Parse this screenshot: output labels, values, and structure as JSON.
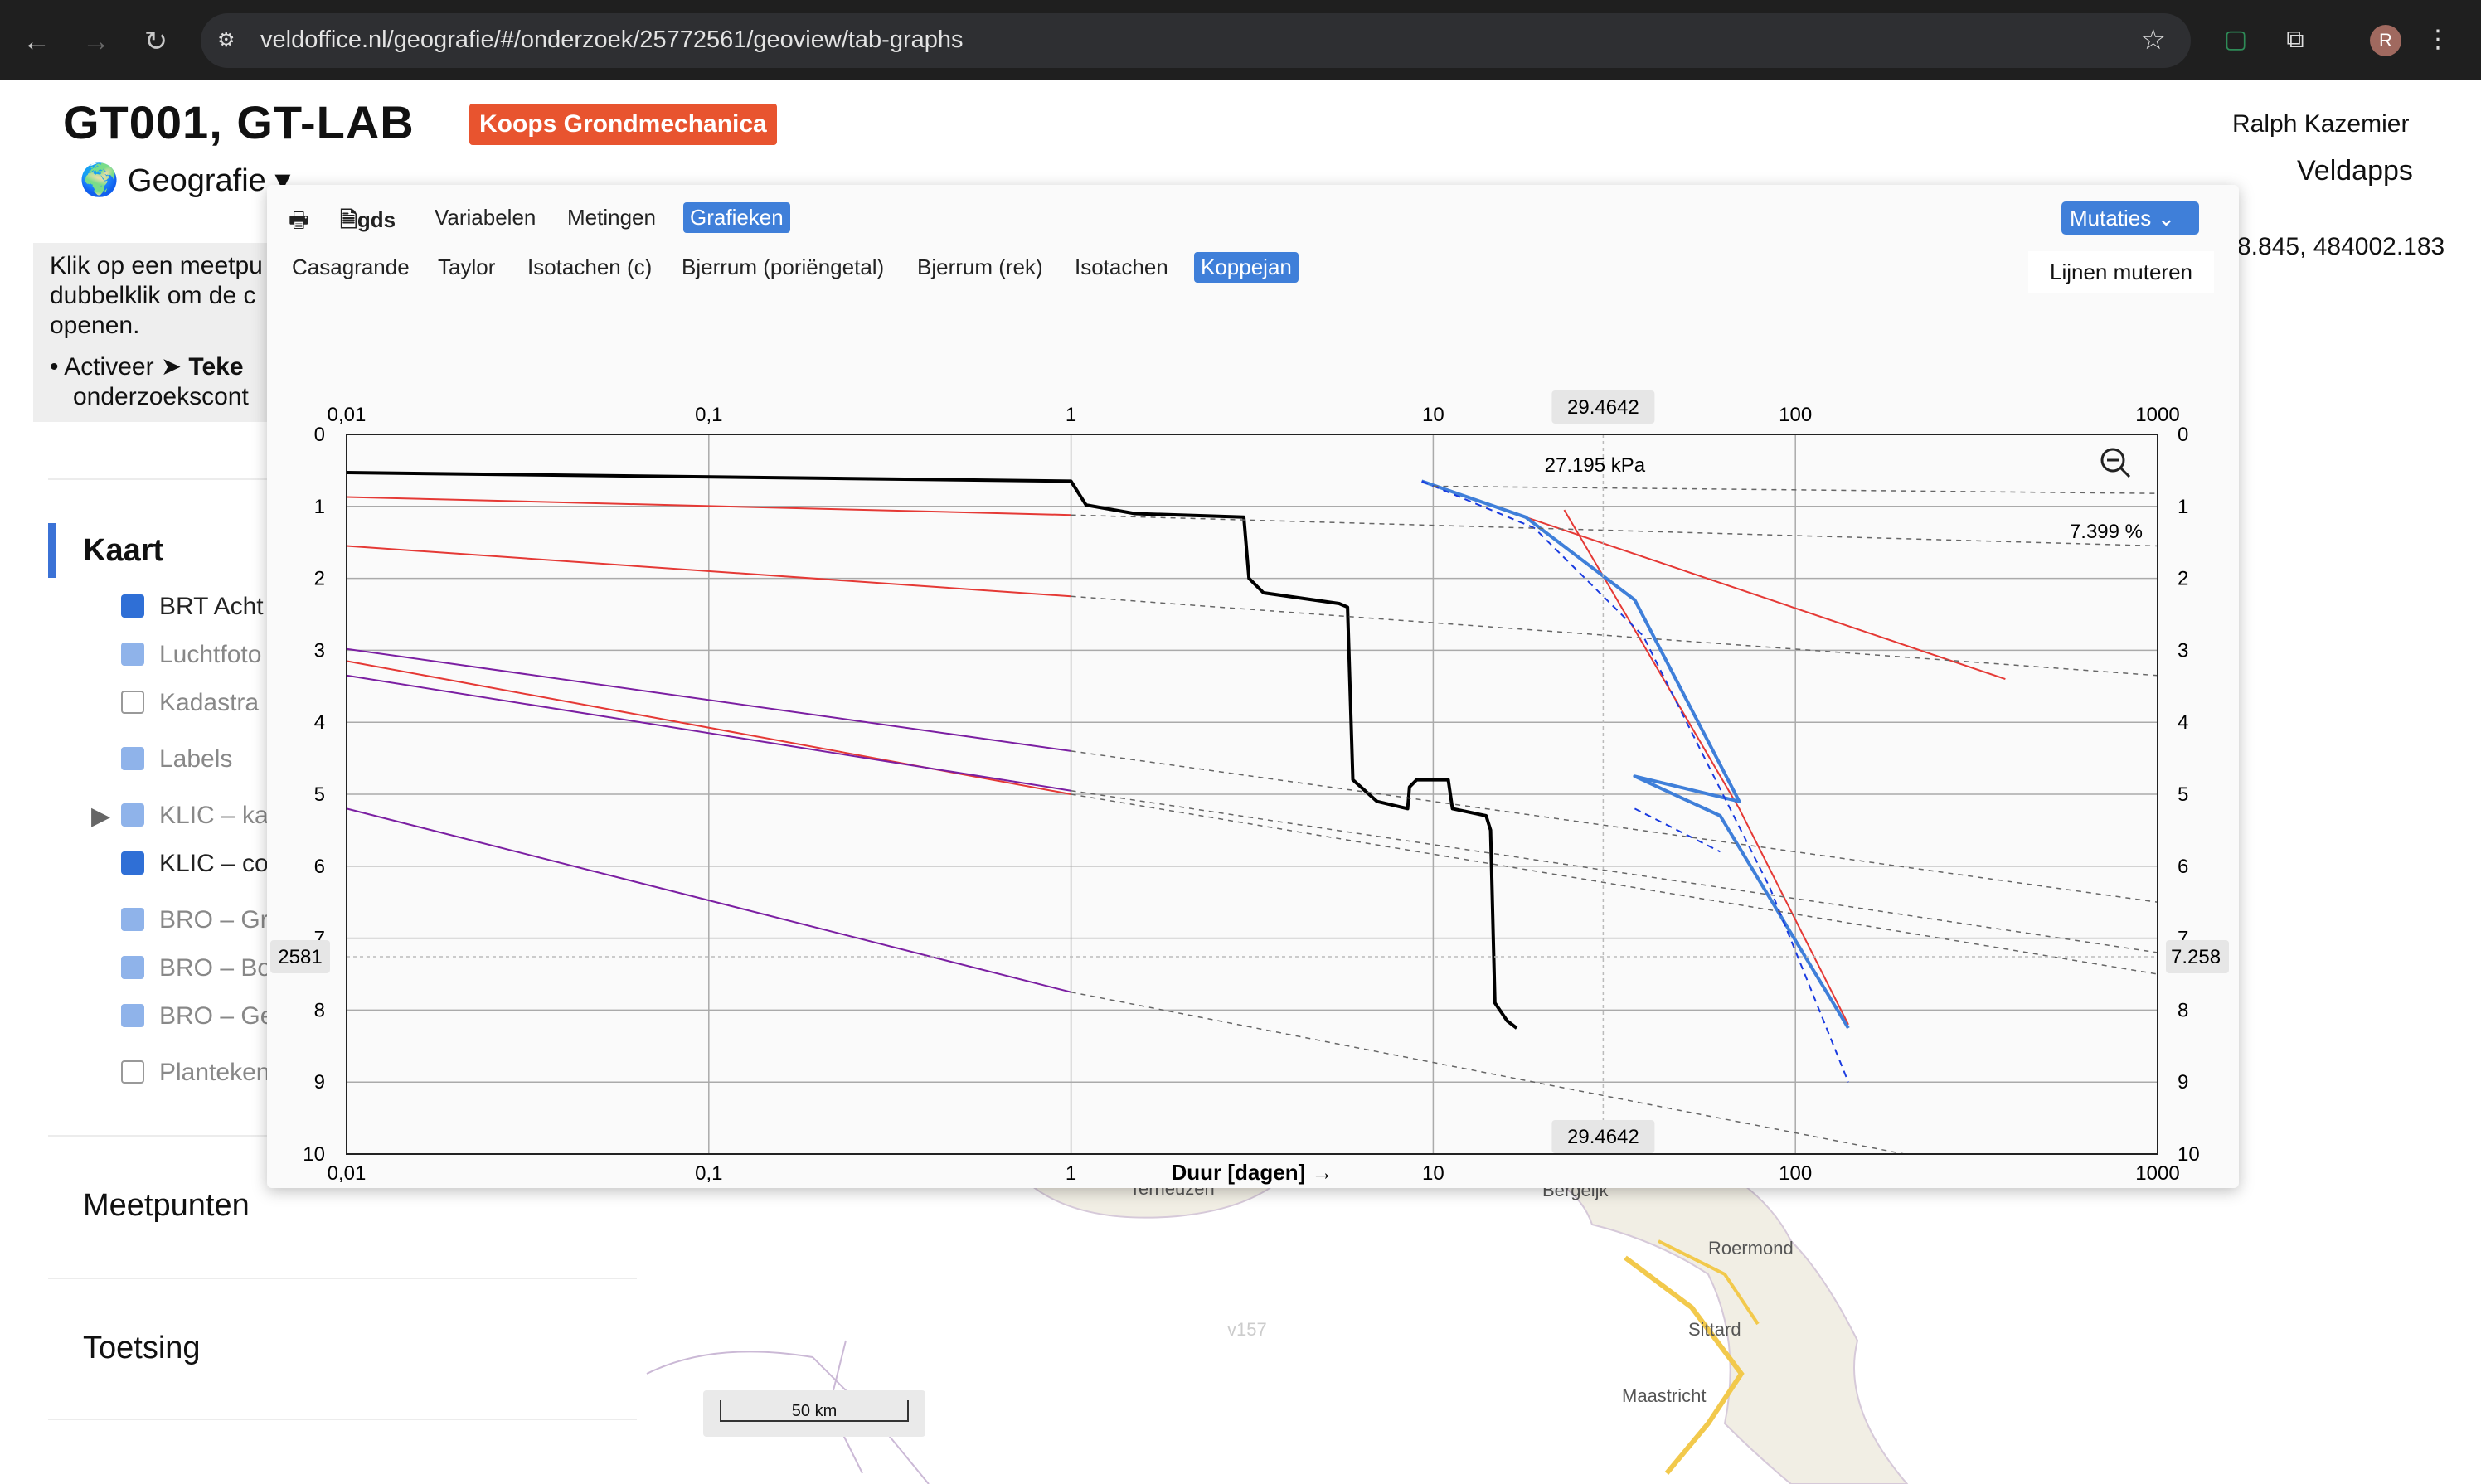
{
  "browser": {
    "url": "veldoffice.nl/geografie/#/onderzoek/25772561/geoview/tab-graphs",
    "profile_initial": "R"
  },
  "header": {
    "title": "GT001, GT-LAB",
    "badge": "Koops Grondmechanica",
    "section": "Geografie",
    "user": "Ralph Kazemier",
    "company": "Veldapps",
    "coords": "8.845, 484002.183"
  },
  "info": {
    "line1": "Klik op een meetpu",
    "line2": "dubbelklik om de c",
    "line3": "openen.",
    "bullet": "Activeer",
    "bullet_bold": "Teke",
    "bullet2": "onderzoekscont"
  },
  "sidebar": {
    "kaart": "Kaart",
    "layers": [
      {
        "label": "BRT Acht",
        "state": "on"
      },
      {
        "label": "Luchtfoto",
        "state": "dim"
      },
      {
        "label": "Kadastra",
        "state": "off"
      },
      {
        "label": "Labels",
        "state": "dim"
      },
      {
        "label": "KLIC – ka",
        "state": "dim"
      },
      {
        "label": "KLIC – co",
        "state": "on"
      },
      {
        "label": "BRO – Gr",
        "state": "dim"
      },
      {
        "label": "BRO – Bo",
        "state": "dim"
      },
      {
        "label": "BRO – Ge",
        "state": "dim"
      },
      {
        "label": "Planteken",
        "state": "off"
      }
    ],
    "meetpunten": "Meetpunten",
    "toetsing": "Toetsing"
  },
  "map": {
    "scale": "50 km",
    "towns": [
      "Terneuzen",
      "Bergeijk",
      "Roermond",
      "Sittard",
      "Maastricht",
      "v157"
    ]
  },
  "modal": {
    "top_tabs": [
      "gds",
      "Variabelen",
      "Metingen",
      "Grafieken"
    ],
    "active_top": "Grafieken",
    "sub_tabs": [
      "Casagrande",
      "Taylor",
      "Isotachen (c)",
      "Bjerrum (poriëngetal)",
      "Bjerrum (rek)",
      "Isotachen",
      "Koppejan"
    ],
    "active_sub": "Koppejan",
    "mutaties": "Mutaties",
    "lijnen": "Lijnen muteren"
  },
  "chart_data": {
    "type": "line",
    "xlabel": "Duur [dagen] →",
    "xscale": "log",
    "xlim": [
      0.01,
      1000
    ],
    "ylim": [
      10,
      0
    ],
    "x_ticks": [
      "0,01",
      "0,1",
      "1",
      "10",
      "100",
      "1000"
    ],
    "y_ticks": [
      "0",
      "1",
      "2",
      "3",
      "4",
      "5",
      "6",
      "7",
      "8",
      "9",
      "10"
    ],
    "crosshair_x": "29.4642",
    "crosshair_left": "2581",
    "crosshair_right": "7.258",
    "annotation_load": "27.195 kPa",
    "annotation_strain": "7.399 %",
    "series": [
      {
        "color": "#000000",
        "width": 4,
        "points": [
          [
            0.01,
            0.53
          ],
          [
            1,
            0.65
          ],
          [
            1.1,
            0.98
          ],
          [
            1.5,
            1.1
          ],
          [
            3,
            1.15
          ],
          [
            3.1,
            2.0
          ],
          [
            3.4,
            2.2
          ],
          [
            5.5,
            2.35
          ],
          [
            5.8,
            2.4
          ],
          [
            6,
            4.8
          ],
          [
            7,
            5.1
          ],
          [
            8.5,
            5.2
          ],
          [
            8.6,
            4.9
          ],
          [
            9,
            4.8
          ],
          [
            11,
            4.8
          ],
          [
            11.3,
            5.2
          ],
          [
            14,
            5.3
          ],
          [
            14.4,
            5.5
          ],
          [
            14.8,
            7.9
          ],
          [
            16,
            8.15
          ],
          [
            17,
            8.25
          ]
        ]
      },
      {
        "color": "#e53935",
        "width": 2,
        "points": [
          [
            0.01,
            0.87
          ],
          [
            1,
            1.12
          ]
        ]
      },
      {
        "color": "#e53935",
        "width": 2,
        "points": [
          [
            0.01,
            1.55
          ],
          [
            1,
            2.25
          ]
        ]
      },
      {
        "color": "#e53935",
        "width": 2,
        "points": [
          [
            0.01,
            3.15
          ],
          [
            1,
            5.0
          ]
        ]
      },
      {
        "color": "#7b1fa2",
        "width": 2,
        "points": [
          [
            0.01,
            2.98
          ],
          [
            1,
            4.4
          ]
        ]
      },
      {
        "color": "#7b1fa2",
        "width": 2,
        "points": [
          [
            0.01,
            3.35
          ],
          [
            1,
            4.95
          ]
        ]
      },
      {
        "color": "#7b1fa2",
        "width": 2,
        "points": [
          [
            0.01,
            5.2
          ],
          [
            1,
            7.75
          ]
        ]
      },
      {
        "color": "#e53935",
        "width": 2,
        "points": [
          [
            9.3,
            0.65
          ],
          [
            18,
            1.15
          ],
          [
            380,
            3.4
          ]
        ]
      },
      {
        "color": "#e53935",
        "width": 2,
        "points": [
          [
            23,
            1.05
          ],
          [
            34,
            2.5
          ],
          [
            70,
            5.2
          ],
          [
            140,
            8.2
          ]
        ]
      },
      {
        "color": "#3f7fd9",
        "width": 4,
        "points": [
          [
            9.3,
            0.65
          ],
          [
            18,
            1.15
          ],
          [
            36,
            2.3
          ],
          [
            70,
            5.1
          ],
          [
            36,
            4.75
          ],
          [
            62,
            5.3
          ],
          [
            140,
            8.25
          ]
        ]
      },
      {
        "color": "#1a3be0",
        "width": 2,
        "dash": "8,6",
        "points": [
          [
            9.3,
            0.65
          ],
          [
            19,
            1.3
          ],
          [
            38,
            2.8
          ],
          [
            85,
            6.3
          ],
          [
            140,
            9.0
          ]
        ]
      },
      {
        "color": "#1a3be0",
        "width": 2,
        "dash": "8,6",
        "points": [
          [
            36,
            5.2
          ],
          [
            62,
            5.8
          ]
        ]
      },
      {
        "color": "#666666",
        "width": 1.5,
        "dash": "6,6",
        "points": [
          [
            1,
            4.4
          ],
          [
            1000,
            6.5
          ]
        ]
      },
      {
        "color": "#666666",
        "width": 1.5,
        "dash": "6,6",
        "points": [
          [
            1,
            4.95
          ],
          [
            1000,
            7.2
          ]
        ]
      },
      {
        "color": "#666666",
        "width": 1.5,
        "dash": "6,6",
        "points": [
          [
            1,
            5.0
          ],
          [
            1000,
            7.5
          ]
        ]
      },
      {
        "color": "#666666",
        "width": 1.5,
        "dash": "6,6",
        "points": [
          [
            1,
            2.25
          ],
          [
            1000,
            3.35
          ]
        ]
      },
      {
        "color": "#666666",
        "width": 1.5,
        "dash": "6,6",
        "points": [
          [
            1,
            1.12
          ],
          [
            1000,
            1.55
          ]
        ]
      },
      {
        "color": "#666666",
        "width": 1.5,
        "dash": "6,6",
        "points": [
          [
            10,
            0.72
          ],
          [
            1000,
            0.82
          ]
        ]
      },
      {
        "color": "#666666",
        "width": 1.5,
        "dash": "6,6",
        "points": [
          [
            1,
            7.75
          ],
          [
            200,
            10.0
          ]
        ]
      }
    ]
  }
}
